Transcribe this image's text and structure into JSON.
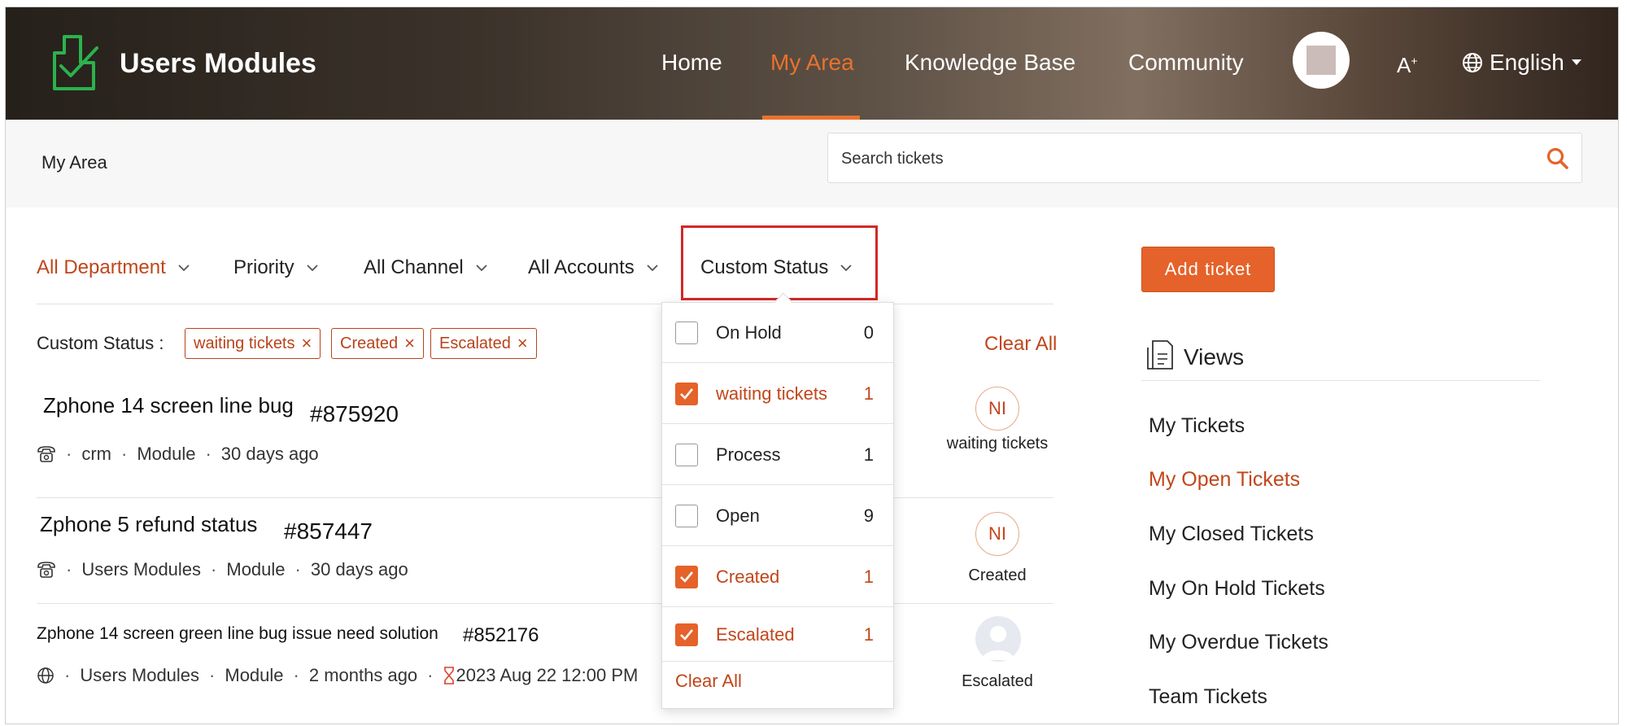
{
  "header": {
    "brand": "Users Modules",
    "nav": [
      {
        "label": "Home"
      },
      {
        "label": "My Area",
        "active": true
      },
      {
        "label": "Knowledge Base"
      },
      {
        "label": "Community"
      }
    ],
    "font_size_icon_label": "A",
    "language": "English",
    "accent_color": "#e8722d"
  },
  "subbar": {
    "title": "My Area",
    "search_placeholder": "Search tickets"
  },
  "filters": [
    {
      "label": "All Department",
      "active": true
    },
    {
      "label": "Priority"
    },
    {
      "label": "All Channel"
    },
    {
      "label": "All Accounts"
    },
    {
      "label": "Custom Status",
      "highlighted": true
    }
  ],
  "applied": {
    "label": "Custom Status :",
    "chips": [
      "waiting tickets",
      "Created",
      "Escalated"
    ],
    "clear_all": "Clear All"
  },
  "tickets": [
    {
      "title": "Zphone 14 screen line bug",
      "id": "#875920",
      "channel_icon": "phone-icon",
      "account": "crm",
      "module": "Module",
      "time": "30 days ago",
      "assignee": "NI",
      "status": "waiting tickets"
    },
    {
      "title": "Zphone 5 refund status",
      "id": "#857447",
      "channel_icon": "phone-icon",
      "account": "Users Modules",
      "module": "Module",
      "time": "30 days ago",
      "assignee": "NI",
      "status": "Created"
    },
    {
      "title": "Zphone 14 screen green line bug issue need solution",
      "id": "#852176",
      "channel_icon": "globe-icon",
      "account": "Users Modules",
      "module": "Module",
      "time": "2 months ago",
      "due": "2023 Aug 22 12:00 PM",
      "assignee": "",
      "status": "Escalated"
    }
  ],
  "dropdown": {
    "items": [
      {
        "label": "On Hold",
        "count": "0",
        "checked": false
      },
      {
        "label": "waiting tickets",
        "count": "1",
        "checked": true
      },
      {
        "label": "Process",
        "count": "1",
        "checked": false
      },
      {
        "label": "Open",
        "count": "9",
        "checked": false
      },
      {
        "label": "Created",
        "count": "1",
        "checked": true
      },
      {
        "label": "Escalated",
        "count": "1",
        "checked": true
      }
    ],
    "clear_all": "Clear All"
  },
  "sidebar": {
    "add_ticket": "Add ticket",
    "views_title": "Views",
    "views": [
      {
        "label": "My Tickets"
      },
      {
        "label": "My Open Tickets",
        "active": true
      },
      {
        "label": "My Closed Tickets"
      },
      {
        "label": "My On Hold Tickets"
      },
      {
        "label": "My Overdue Tickets"
      },
      {
        "label": "Team Tickets"
      }
    ]
  }
}
